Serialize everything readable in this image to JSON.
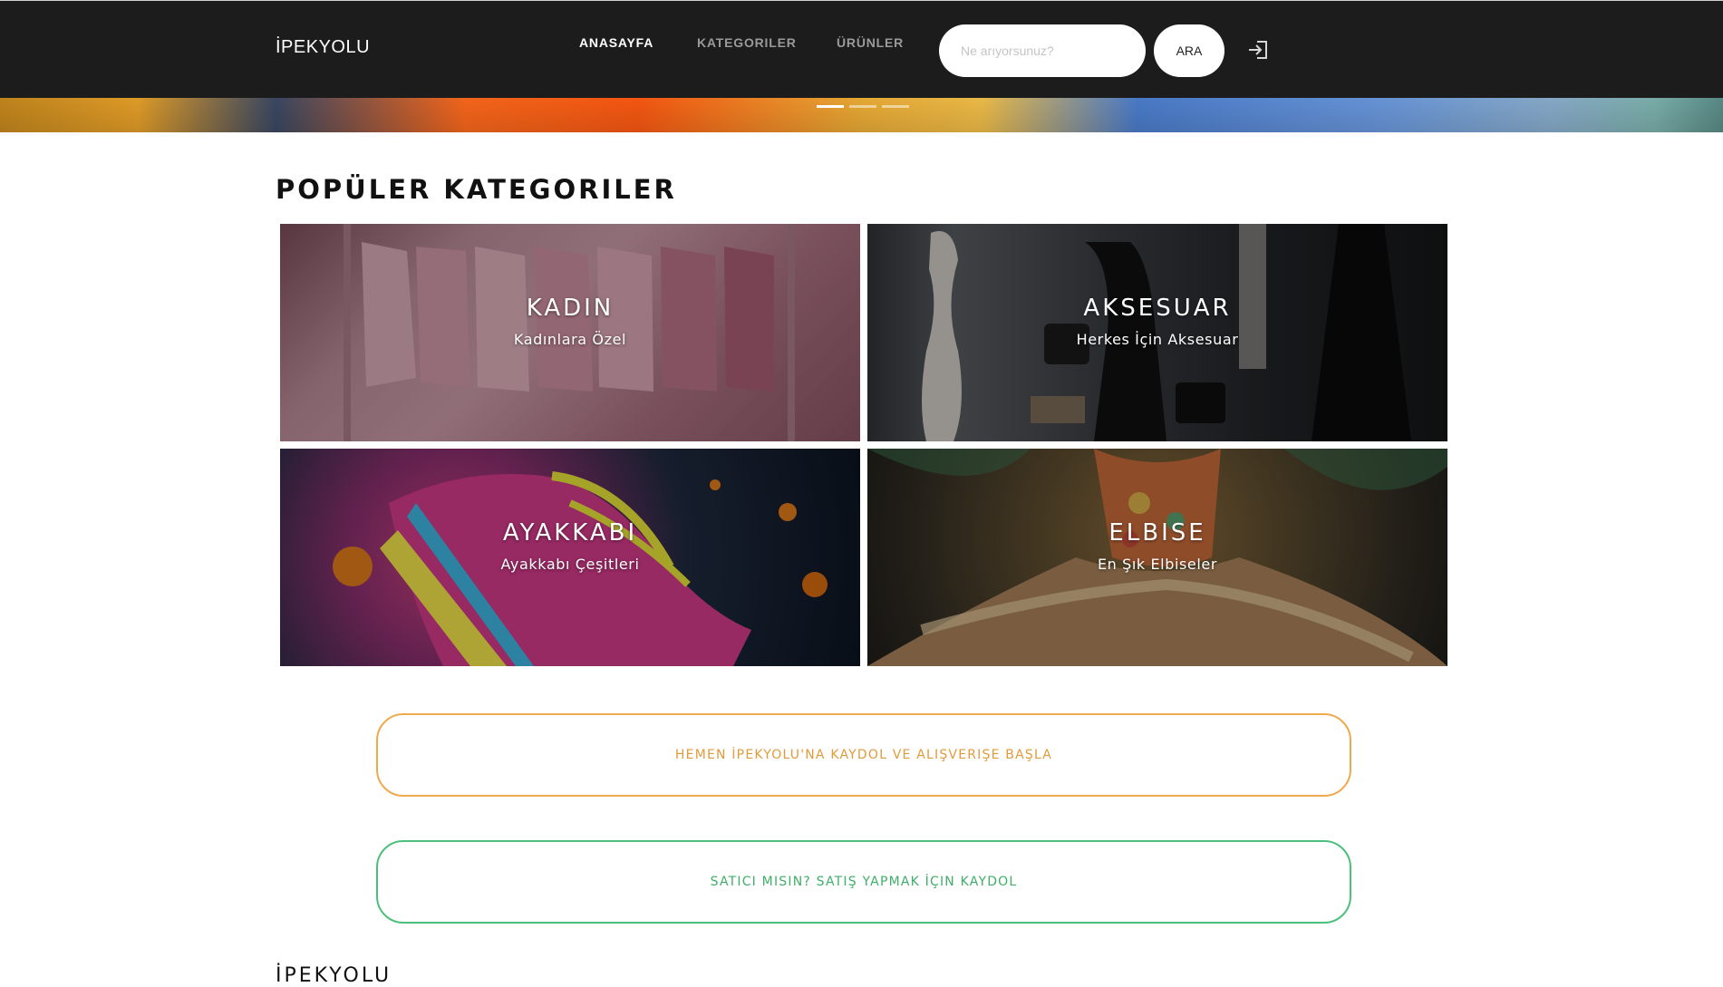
{
  "header": {
    "brand": "İPEKYOLU",
    "nav": [
      {
        "label": "ANASAYFA"
      },
      {
        "label": "KATEGORILER"
      },
      {
        "label": "ÜRÜNLER"
      }
    ],
    "search": {
      "placeholder": "Ne arıyorsunuz?",
      "value": "",
      "button_label": "ARA"
    },
    "login_icon": "login-icon"
  },
  "hero": {
    "slides_count": 3,
    "active_slide": 1
  },
  "categories_section": {
    "title": "POPÜLER KATEGORILER",
    "items": [
      {
        "title": "KADIN",
        "subtitle": "Kadınlara Özel"
      },
      {
        "title": "AKSESUAR",
        "subtitle": "Herkes İçin Aksesuar"
      },
      {
        "title": "AYAKKABI",
        "subtitle": "Ayakkabı Çeşitleri"
      },
      {
        "title": "ELBISE",
        "subtitle": "En Şık Elbiseler"
      }
    ]
  },
  "cta": {
    "customer_label": "HEMEN İPEKYOLU'NA KAYDOL VE ALIŞVERIŞE BAŞLA",
    "seller_label": "SATICI MISIN? SATIŞ YAPMAK İÇIN KAYDOL"
  },
  "footer": {
    "brand": "İPEKYOLU"
  },
  "colors": {
    "navbar_bg": "#1c1c1c",
    "customer_cta": "#e39a3a",
    "seller_cta": "#3fae68"
  }
}
